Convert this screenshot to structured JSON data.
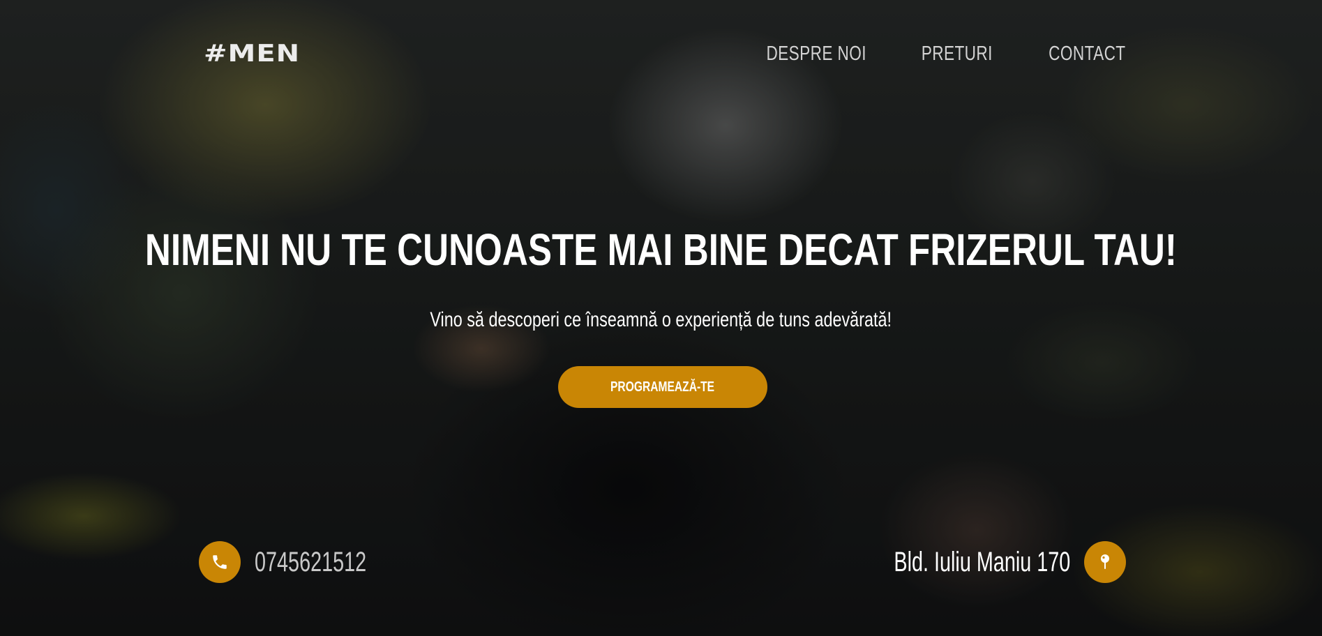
{
  "header": {
    "logo": "#MEN",
    "nav": [
      {
        "label": "DESPRE NOI"
      },
      {
        "label": "PRETURI"
      },
      {
        "label": "CONTACT"
      }
    ]
  },
  "hero": {
    "headline": "NIMENI NU TE CUNOASTE MAI BINE DECAT FRIZERUL TAU!",
    "subline": "Vino să descoperi ce înseamnă o experiență de tuns adevărată!",
    "cta_label": "PROGRAMEAZĂ-TE"
  },
  "contact": {
    "phone": "0745621512",
    "address": "Bld. Iuliu Maniu 170",
    "phone_icon": "phone-icon",
    "location_icon": "map-pin-icon"
  },
  "colors": {
    "accent": "#c98605",
    "nav_text": "#d3d3d3",
    "text": "#ffffff"
  }
}
